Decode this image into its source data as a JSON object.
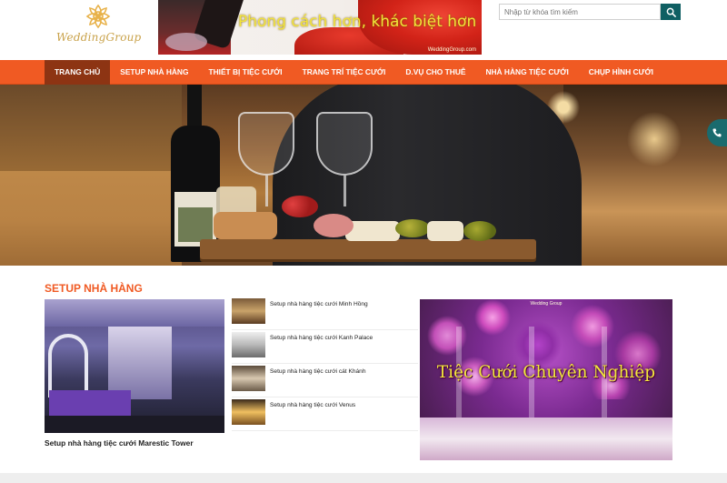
{
  "header": {
    "logo_text": "WeddingGroup",
    "banner_text": "Phong cách hơn, khác biệt hơn ...",
    "banner_url": "WeddingGroup.com"
  },
  "search": {
    "placeholder": "Nhập từ khóa tìm kiếm",
    "icon": "search-icon"
  },
  "nav": {
    "items": [
      {
        "label": "TRANG CHỦ",
        "active": true
      },
      {
        "label": "SETUP NHÀ HÀNG",
        "active": false
      },
      {
        "label": "THIẾT BỊ TIỆC CƯỚI",
        "active": false
      },
      {
        "label": "TRANG TRÍ TIỆC CƯỚI",
        "active": false
      },
      {
        "label": "D.VỤ CHO THUÊ",
        "active": false
      },
      {
        "label": "NHÀ HÀNG TIỆC CƯỚI",
        "active": false
      },
      {
        "label": "CHỤP HÌNH CƯỚI",
        "active": false
      }
    ]
  },
  "hero": {
    "phone_icon": "phone-icon"
  },
  "section": {
    "title": "SETUP NHÀ HÀNG",
    "feature_caption": "Setup nhà hàng tiệc cưới Marestic Tower",
    "list": [
      {
        "label": "Setup nhà hàng tiệc cưới Minh Hồng"
      },
      {
        "label": "Setup nhà hàng tiệc cưới Kanh Palace"
      },
      {
        "label": "Setup nhà hàng tiệc cưới cát Khánh"
      },
      {
        "label": "Setup nhà hàng tiệc cưới Venus"
      }
    ],
    "promo_label": "Wedding Group",
    "promo_text": "Tiệc Cưới Chuyên Nghiệp"
  },
  "colors": {
    "accent": "#f05a23",
    "nav_active": "#8d3413",
    "search_button": "#0f5f63",
    "banner_text": "#f2e33a"
  }
}
